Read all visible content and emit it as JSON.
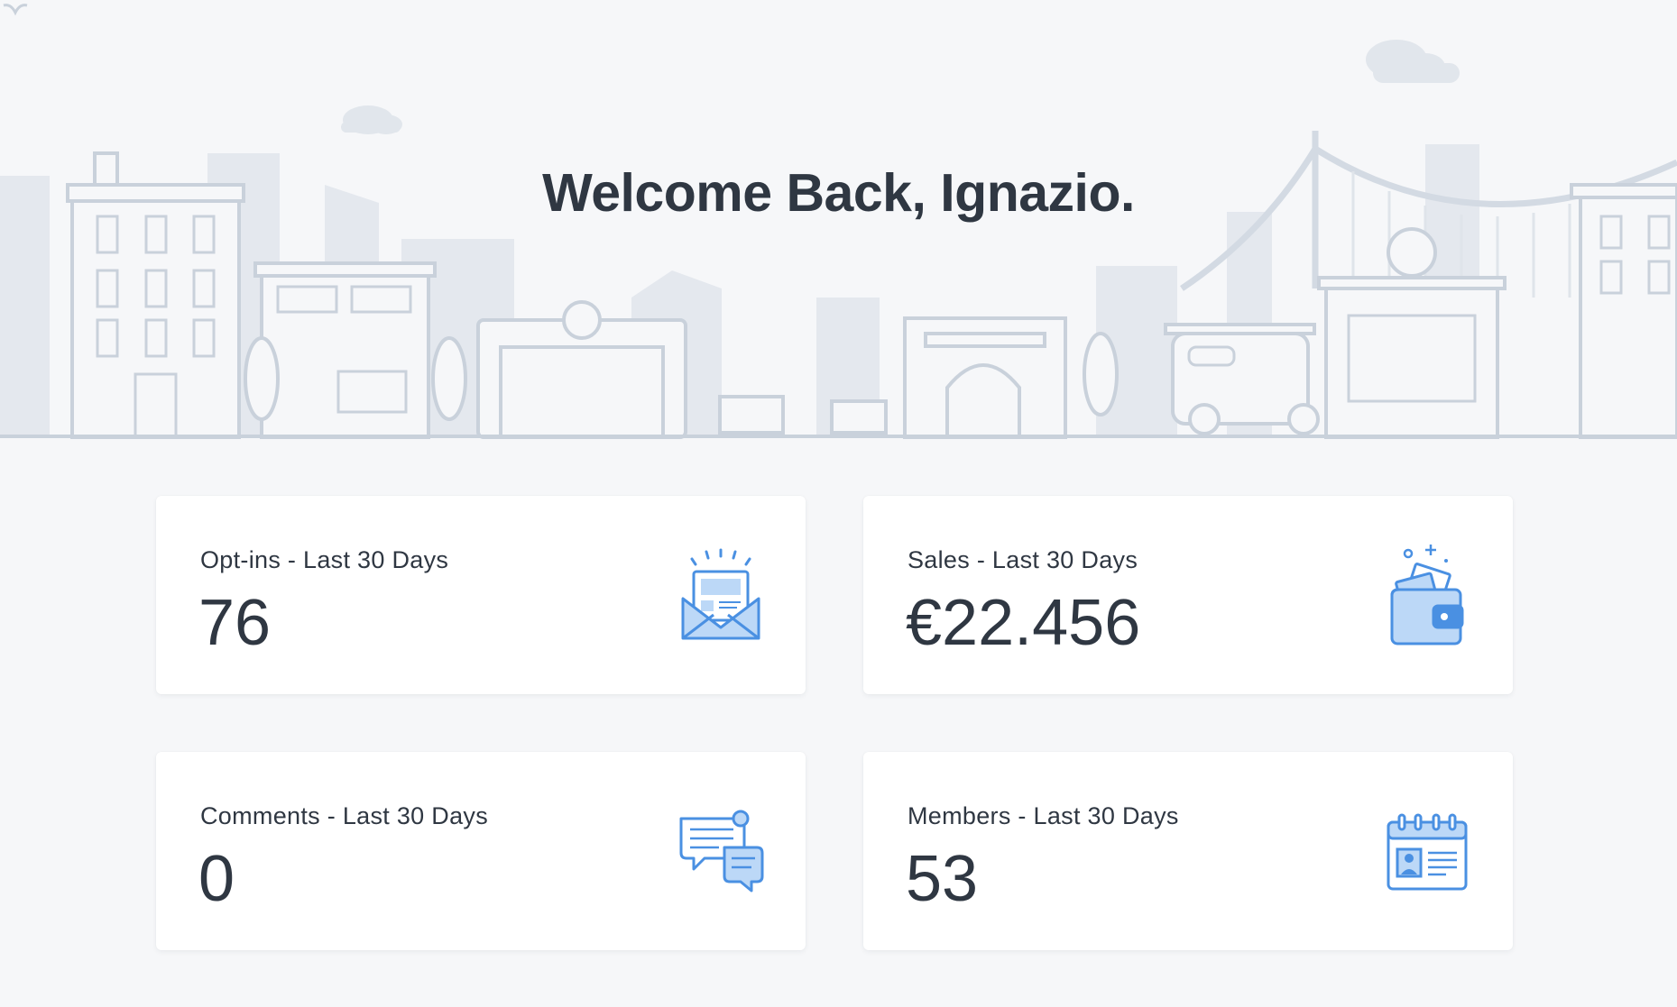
{
  "header": {
    "welcome_text": "Welcome Back, Ignazio."
  },
  "stats": [
    {
      "label": "Opt-ins - Last 30 Days",
      "value": "76",
      "icon": "newsletter-envelope-icon"
    },
    {
      "label": "Sales - Last 30 Days",
      "value": "€22.456",
      "icon": "wallet-icon"
    },
    {
      "label": "Comments - Last 30 Days",
      "value": "0",
      "icon": "chat-bubbles-icon"
    },
    {
      "label": "Members - Last 30 Days",
      "value": "53",
      "icon": "member-card-calendar-icon"
    }
  ],
  "colors": {
    "background": "#f6f7f9",
    "text": "#2f3742",
    "illustration_line": "#c9d1db",
    "illustration_fill": "#e6eaef",
    "icon_blue": "#4a90e2",
    "icon_light_blue": "#bcd8f7"
  }
}
